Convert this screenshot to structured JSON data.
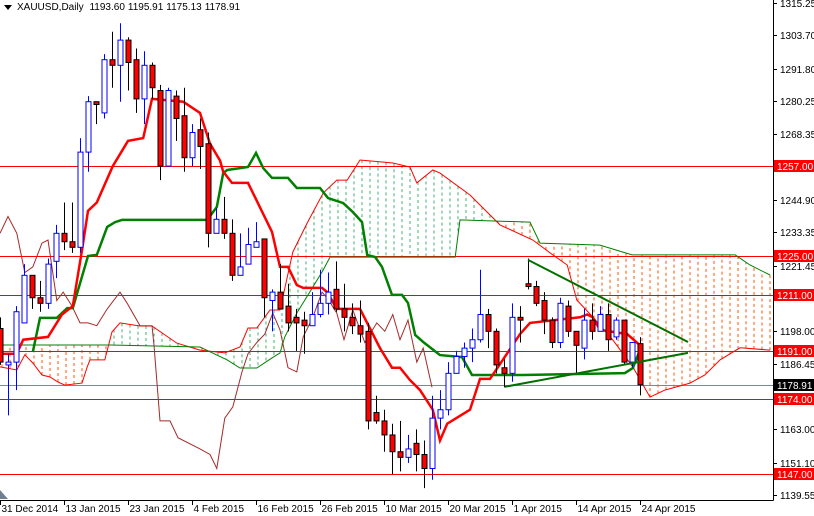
{
  "header": {
    "symbol_timeframe": "XAUUSD,Daily",
    "open": "1193.60",
    "high": "1195.91",
    "low": "1175.13",
    "close": "1178.91"
  },
  "colors": {
    "bull": "#0000ff",
    "bear": "#ff0000",
    "tenkan": "#ff0000",
    "kijun": "#008000",
    "chikou": "#a52a2a",
    "senkou_a": "#ff0000",
    "senkou_b": "#008000",
    "cloud_bull": "#3cb371",
    "cloud_bear": "#ff5500",
    "hline": "#ff0000",
    "current_line": "#778899",
    "trendline": "#007000"
  },
  "chart_data": {
    "type": "candlestick",
    "title": "XAUUSD,Daily",
    "ylim": [
      1139.55,
      1315.25
    ],
    "y_ticks": [
      "1315.25",
      "1303.70",
      "1291.80",
      "1280.25",
      "1268.35",
      "1244.90",
      "1233.35",
      "1221.45",
      "1198.00",
      "1186.45",
      "1163.00",
      "1151.10",
      "1139.55"
    ],
    "x_labels": [
      {
        "bar": 0,
        "label": "31 Dec 2014"
      },
      {
        "bar": 8,
        "label": "13 Jan 2015"
      },
      {
        "bar": 16,
        "label": "23 Jan 2015"
      },
      {
        "bar": 24,
        "label": "4 Feb 2015"
      },
      {
        "bar": 32,
        "label": "16 Feb 2015"
      },
      {
        "bar": 40,
        "label": "26 Feb 2015"
      },
      {
        "bar": 48,
        "label": "10 Mar 2015"
      },
      {
        "bar": 56,
        "label": "20 Mar 2015"
      },
      {
        "bar": 64,
        "label": "1 Apr 2015"
      },
      {
        "bar": 72,
        "label": "14 Apr 2015"
      },
      {
        "bar": 80,
        "label": "24 Apr 2015"
      }
    ],
    "ohlc": [
      [
        1199,
        1203,
        1186,
        1187
      ],
      [
        1186,
        1190,
        1168,
        1187
      ],
      [
        1187,
        1207,
        1177,
        1205
      ],
      [
        1201,
        1222,
        1201,
        1218
      ],
      [
        1218,
        1218,
        1206,
        1210
      ],
      [
        1210,
        1216,
        1205,
        1208
      ],
      [
        1208,
        1224,
        1206,
        1222
      ],
      [
        1223,
        1236,
        1217,
        1233
      ],
      [
        1233,
        1244,
        1227,
        1230
      ],
      [
        1230,
        1244,
        1226,
        1228
      ],
      [
        1228,
        1267,
        1226,
        1262
      ],
      [
        1262,
        1282,
        1255,
        1280
      ],
      [
        1280,
        1280,
        1272,
        1279
      ],
      [
        1276,
        1297,
        1274,
        1295
      ],
      [
        1295,
        1305,
        1285,
        1293
      ],
      [
        1293,
        1308,
        1280,
        1302
      ],
      [
        1302,
        1303,
        1284,
        1294
      ],
      [
        1295,
        1299,
        1276,
        1281
      ],
      [
        1281,
        1298,
        1272,
        1293
      ],
      [
        1293,
        1294,
        1281,
        1285
      ],
      [
        1284,
        1286,
        1252,
        1257
      ],
      [
        1257,
        1285,
        1257,
        1284
      ],
      [
        1282,
        1284,
        1266,
        1274
      ],
      [
        1275,
        1285,
        1255,
        1260
      ],
      [
        1260,
        1272,
        1257,
        1269
      ],
      [
        1270,
        1274,
        1256,
        1264
      ],
      [
        1265,
        1269,
        1228,
        1233
      ],
      [
        1233,
        1242,
        1234,
        1238
      ],
      [
        1238,
        1246,
        1231,
        1233
      ],
      [
        1233,
        1238,
        1216,
        1218
      ],
      [
        1218,
        1233,
        1218,
        1221
      ],
      [
        1222,
        1235,
        1222,
        1229
      ],
      [
        1228,
        1237,
        1228,
        1230
      ],
      [
        1231,
        1231,
        1203,
        1210
      ],
      [
        1209,
        1213,
        1198,
        1212
      ],
      [
        1212,
        1222,
        1206,
        1206
      ],
      [
        1207,
        1215,
        1198,
        1201
      ],
      [
        1203,
        1206,
        1191,
        1201
      ],
      [
        1202,
        1205,
        1190,
        1200
      ],
      [
        1200,
        1212,
        1200,
        1204
      ],
      [
        1204,
        1220,
        1203,
        1208
      ],
      [
        1208,
        1219,
        1204,
        1212
      ],
      [
        1213,
        1223,
        1205,
        1206
      ],
      [
        1206,
        1215,
        1198,
        1203
      ],
      [
        1203,
        1208,
        1197,
        1200
      ],
      [
        1200,
        1209,
        1194,
        1197
      ],
      [
        1198,
        1201,
        1163,
        1166
      ],
      [
        1169,
        1175,
        1165,
        1166
      ],
      [
        1166,
        1170,
        1155,
        1161
      ],
      [
        1161,
        1165,
        1147,
        1155
      ],
      [
        1155,
        1166,
        1148,
        1153
      ],
      [
        1153,
        1161,
        1151,
        1156
      ],
      [
        1158,
        1163,
        1148,
        1154
      ],
      [
        1154,
        1159,
        1142,
        1149
      ],
      [
        1149,
        1175,
        1145,
        1167
      ],
      [
        1167,
        1177,
        1163,
        1170
      ],
      [
        1170,
        1187,
        1168,
        1183
      ],
      [
        1183,
        1191,
        1185,
        1189
      ],
      [
        1189,
        1194,
        1185,
        1192
      ],
      [
        1192,
        1199,
        1187,
        1195
      ],
      [
        1195,
        1220,
        1194,
        1204
      ],
      [
        1204,
        1206,
        1192,
        1198
      ],
      [
        1198,
        1199,
        1183,
        1186
      ],
      [
        1185,
        1188,
        1178,
        1183
      ],
      [
        1183,
        1208,
        1180,
        1203
      ],
      [
        1203,
        1207,
        1194,
        1202
      ],
      [
        1215,
        1224,
        1213,
        1214
      ],
      [
        1214,
        1216,
        1207,
        1208
      ],
      [
        1209,
        1212,
        1197,
        1202
      ],
      [
        1202,
        1203,
        1192,
        1194
      ],
      [
        1194,
        1210,
        1192,
        1208
      ],
      [
        1207,
        1209,
        1196,
        1198
      ],
      [
        1198,
        1198,
        1183,
        1193
      ],
      [
        1192,
        1206,
        1188,
        1202
      ],
      [
        1202,
        1208,
        1195,
        1198
      ],
      [
        1198,
        1207,
        1198,
        1204
      ],
      [
        1204,
        1208,
        1191,
        1195
      ],
      [
        1196,
        1203,
        1195,
        1202
      ],
      [
        1202,
        1202,
        1186,
        1187
      ],
      [
        1187,
        1194,
        1185,
        1194
      ],
      [
        1193.6,
        1195.91,
        1175.13,
        1178.91
      ]
    ],
    "tenkan": [
      [
        0,
        1190
      ],
      [
        2.1,
        1190
      ],
      [
        2.9,
        1195
      ],
      [
        6,
        1196
      ],
      [
        7.75,
        1204
      ],
      [
        9.1,
        1207
      ],
      [
        10.25,
        1227
      ],
      [
        11,
        1241
      ],
      [
        12.1,
        1244
      ],
      [
        14.1,
        1257
      ],
      [
        16,
        1266
      ],
      [
        17.9,
        1267
      ],
      [
        19,
        1281
      ],
      [
        22.9,
        1280
      ],
      [
        25,
        1276
      ],
      [
        26.25,
        1265
      ],
      [
        27.5,
        1259
      ],
      [
        27.9,
        1255
      ],
      [
        29,
        1251
      ],
      [
        31,
        1251
      ],
      [
        34,
        1233.5
      ],
      [
        35,
        1221
      ],
      [
        36,
        1221
      ],
      [
        37.1,
        1214.5
      ],
      [
        37.9,
        1213.5
      ],
      [
        40.25,
        1213.5
      ],
      [
        40.9,
        1212
      ],
      [
        42.1,
        1206
      ],
      [
        45,
        1206
      ],
      [
        47.5,
        1192
      ],
      [
        49,
        1185
      ],
      [
        50,
        1185
      ],
      [
        51.25,
        1180.6
      ],
      [
        52.5,
        1177
      ],
      [
        54.1,
        1170
      ],
      [
        55,
        1159
      ],
      [
        55.9,
        1165
      ],
      [
        58.75,
        1170
      ],
      [
        60,
        1181
      ],
      [
        61.25,
        1181
      ],
      [
        62.9,
        1188
      ],
      [
        65,
        1197
      ],
      [
        66.25,
        1201
      ],
      [
        72.5,
        1203
      ],
      [
        73.4,
        1204
      ],
      [
        74.1,
        1203
      ],
      [
        75,
        1198.5
      ],
      [
        78.4,
        1197
      ],
      [
        80,
        1193
      ]
    ],
    "kijun": [
      [
        4.1,
        1190.6
      ],
      [
        5,
        1202.8
      ],
      [
        7.1,
        1202.8
      ],
      [
        8.4,
        1206.3
      ],
      [
        9.1,
        1206.3
      ],
      [
        11,
        1224.9
      ],
      [
        12.1,
        1225.3
      ],
      [
        13.4,
        1235.3
      ],
      [
        14.4,
        1237
      ],
      [
        15.25,
        1237.8
      ],
      [
        25.9,
        1237.8
      ],
      [
        27.1,
        1242.4
      ],
      [
        27.9,
        1254.5
      ],
      [
        28.4,
        1255.6
      ],
      [
        31,
        1256.7
      ],
      [
        32,
        1261.7
      ],
      [
        32.9,
        1256.3
      ],
      [
        34,
        1252.8
      ],
      [
        36,
        1252.8
      ],
      [
        37.1,
        1249.2
      ],
      [
        40,
        1249.2
      ],
      [
        41,
        1245.6
      ],
      [
        42.9,
        1243.8
      ],
      [
        44.1,
        1240.6
      ],
      [
        45.25,
        1237
      ],
      [
        45.9,
        1225.3
      ],
      [
        46.9,
        1224.5
      ],
      [
        47.75,
        1221
      ],
      [
        49,
        1211
      ],
      [
        50.25,
        1211
      ],
      [
        51,
        1208.1
      ],
      [
        51.9,
        1196.7
      ],
      [
        52.9,
        1194.2
      ],
      [
        55,
        1189.5
      ],
      [
        57.75,
        1188.8
      ],
      [
        59,
        1182.4
      ],
      [
        65.4,
        1182.4
      ],
      [
        78.1,
        1183.1
      ],
      [
        79.1,
        1184.9
      ],
      [
        80,
        1191.3
      ]
    ],
    "chikou": [
      [
        0,
        1233
      ],
      [
        1,
        1239
      ],
      [
        2.1,
        1233
      ],
      [
        3.1,
        1219
      ],
      [
        4.1,
        1221
      ],
      [
        5.25,
        1229.5
      ],
      [
        6,
        1230.6
      ],
      [
        7.1,
        1209
      ],
      [
        7.9,
        1212
      ],
      [
        9,
        1207
      ],
      [
        10,
        1201
      ],
      [
        11,
        1201
      ],
      [
        12.1,
        1200
      ],
      [
        13.4,
        1206
      ],
      [
        15,
        1212
      ],
      [
        15.9,
        1208
      ],
      [
        17.5,
        1200
      ],
      [
        19,
        1200
      ],
      [
        19.25,
        1193
      ],
      [
        20,
        1166
      ],
      [
        21.25,
        1166
      ],
      [
        22.25,
        1160
      ],
      [
        25,
        1156
      ],
      [
        26.25,
        1154
      ],
      [
        27.1,
        1149
      ],
      [
        28.1,
        1167
      ],
      [
        29.1,
        1171
      ],
      [
        30.25,
        1183.5
      ],
      [
        31,
        1190
      ],
      [
        32.1,
        1194
      ],
      [
        33.1,
        1197
      ],
      [
        34.1,
        1204.5
      ],
      [
        35,
        1198.5
      ],
      [
        36,
        1185
      ],
      [
        37.1,
        1183.5
      ],
      [
        37.9,
        1196
      ],
      [
        39.1,
        1203
      ],
      [
        40.25,
        1212
      ],
      [
        41,
        1209.5
      ],
      [
        42.1,
        1204.5
      ],
      [
        43,
        1195
      ],
      [
        44.1,
        1205.6
      ],
      [
        45.6,
        1194
      ],
      [
        47.1,
        1201
      ],
      [
        48.1,
        1198
      ],
      [
        49.1,
        1204
      ],
      [
        50,
        1195
      ],
      [
        51,
        1202
      ],
      [
        52.1,
        1187
      ],
      [
        52.9,
        1192
      ],
      [
        54,
        1178
      ]
    ],
    "senkou_a": [
      [
        0,
        1185.3
      ],
      [
        2.1,
        1184.2
      ],
      [
        3.1,
        1189.6
      ],
      [
        4.1,
        1186.7
      ],
      [
        5.25,
        1182.4
      ],
      [
        6.25,
        1181.7
      ],
      [
        7.25,
        1179.9
      ],
      [
        8.1,
        1178.8
      ],
      [
        10.25,
        1179.5
      ],
      [
        10.9,
        1185.3
      ],
      [
        11.25,
        1187.8
      ],
      [
        13.1,
        1187.8
      ],
      [
        14,
        1197.8
      ],
      [
        15,
        1201
      ],
      [
        17.5,
        1199.9
      ],
      [
        19,
        1199.9
      ],
      [
        22.1,
        1193.8
      ],
      [
        25,
        1191.3
      ],
      [
        28.1,
        1190.3
      ],
      [
        30,
        1192.4
      ],
      [
        31,
        1199.2
      ],
      [
        32.1,
        1199.2
      ],
      [
        33.75,
        1205.6
      ],
      [
        35,
        1205.6
      ],
      [
        36.6,
        1226.3
      ],
      [
        38.4,
        1236.7
      ],
      [
        40.4,
        1247.4
      ],
      [
        42.1,
        1252
      ],
      [
        43.4,
        1252
      ],
      [
        45,
        1259.2
      ],
      [
        49.1,
        1258.1
      ],
      [
        51.25,
        1256.7
      ],
      [
        52.1,
        1251
      ],
      [
        54.1,
        1255.6
      ],
      [
        55,
        1254.5
      ],
      [
        58.75,
        1246.7
      ],
      [
        62.5,
        1236
      ],
      [
        66.6,
        1230.6
      ],
      [
        69.1,
        1225.3
      ],
      [
        70.9,
        1221.7
      ],
      [
        72.1,
        1209.2
      ],
      [
        74.1,
        1203.1
      ],
      [
        76.6,
        1194.9
      ],
      [
        79.1,
        1185.3
      ],
      [
        81.25,
        1174.5
      ],
      [
        83.1,
        1177
      ],
      [
        86.25,
        1179.5
      ],
      [
        88.1,
        1182.4
      ],
      [
        90,
        1187.8
      ],
      [
        92.5,
        1192.1
      ],
      [
        96.25,
        1191.3
      ]
    ],
    "senkou_b": [
      [
        0,
        1193.1
      ],
      [
        13.75,
        1193.1
      ],
      [
        25,
        1192.4
      ],
      [
        28.4,
        1187.8
      ],
      [
        30,
        1184.9
      ],
      [
        32.1,
        1184.9
      ],
      [
        34,
        1188.5
      ],
      [
        35,
        1190.3
      ],
      [
        35.6,
        1196
      ],
      [
        37.1,
        1204.5
      ],
      [
        39.1,
        1213.8
      ],
      [
        40.4,
        1219.9
      ],
      [
        41.25,
        1224.5
      ],
      [
        56.9,
        1224.5
      ],
      [
        57.5,
        1237.8
      ],
      [
        66.25,
        1237
      ],
      [
        67.5,
        1229.5
      ],
      [
        75,
        1228.8
      ],
      [
        79,
        1225.3
      ],
      [
        91.9,
        1225.3
      ],
      [
        93.75,
        1221.7
      ],
      [
        96.25,
        1218.1
      ]
    ],
    "trendlines": [
      {
        "name": "upper-trendline",
        "from": [
          66,
          1223.5
        ],
        "to": [
          86,
          1194.2
        ]
      },
      {
        "name": "lower-trendline",
        "from": [
          63.1,
          1178.2
        ],
        "to": [
          86,
          1190.3
        ]
      }
    ],
    "horizontal_levels": [
      "1257.00",
      "1225.00",
      "1211.00",
      "1191.00",
      "1174.00",
      "1147.00"
    ],
    "current_price": "1178.91"
  }
}
